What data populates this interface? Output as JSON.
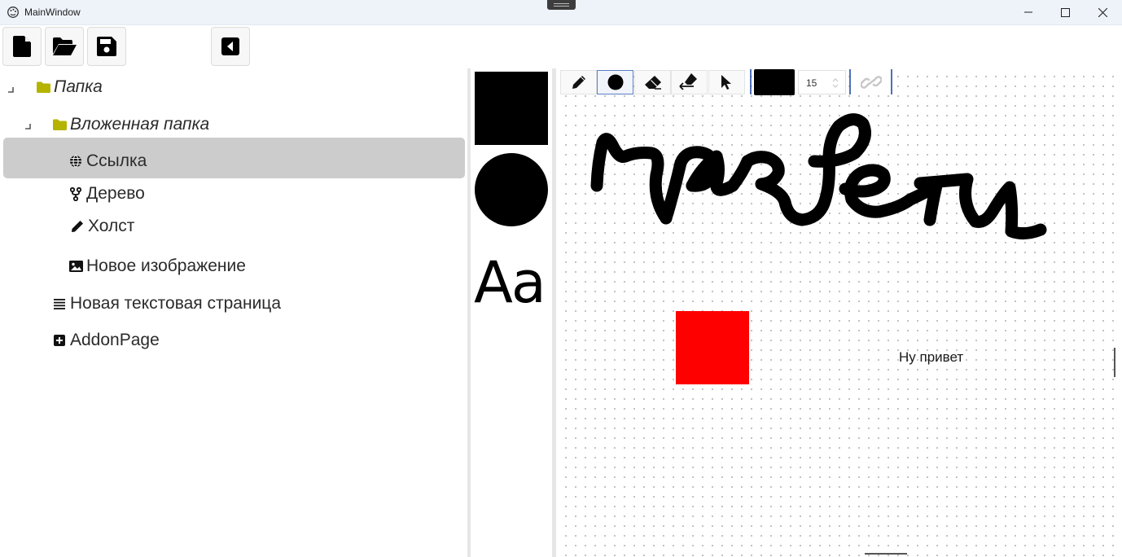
{
  "window": {
    "title": "MainWindow"
  },
  "toolbar": {
    "buttons": [
      {
        "name": "new-file",
        "icon": "file-icon"
      },
      {
        "name": "open-folder",
        "icon": "folder-open-icon"
      },
      {
        "name": "save",
        "icon": "floppy-disk-icon"
      },
      {
        "name": "collapse-panel",
        "icon": "caret-left-square-icon"
      }
    ]
  },
  "tree": {
    "items": [
      {
        "label": "Папка",
        "icon": "folder-icon",
        "italic": true,
        "expanded": true
      },
      {
        "label": "Вложенная папка",
        "icon": "folder-icon",
        "italic": true,
        "expanded": true
      },
      {
        "label": "Ссылка",
        "icon": "globe-icon"
      },
      {
        "label": "Дерево",
        "icon": "branch-icon"
      },
      {
        "label": "Холст",
        "icon": "pencil-icon",
        "selected": true
      },
      {
        "label": "Новое изображение",
        "icon": "image-icon"
      },
      {
        "label": "Новая текстовая страница",
        "icon": "text-lines-icon"
      },
      {
        "label": "AddonPage",
        "icon": "plus-square-icon"
      }
    ]
  },
  "palette": {
    "shapes": [
      "square",
      "circle"
    ],
    "text_sample": "Aa"
  },
  "canvas_toolbar": {
    "tools": [
      "pencil-icon",
      "circle-brush-icon",
      "eraser-icon",
      "erase-back-icon",
      "pointer-icon"
    ],
    "active_tool": "circle-brush-icon",
    "color": "#000000",
    "brush_size": "15",
    "link_icon": "link-icon"
  },
  "canvas": {
    "handwriting_text": "привет",
    "text_box": "Ну привет",
    "square_color": "#ff0000",
    "folder_color": "#b5b300",
    "selection_color": "#cccccc"
  }
}
